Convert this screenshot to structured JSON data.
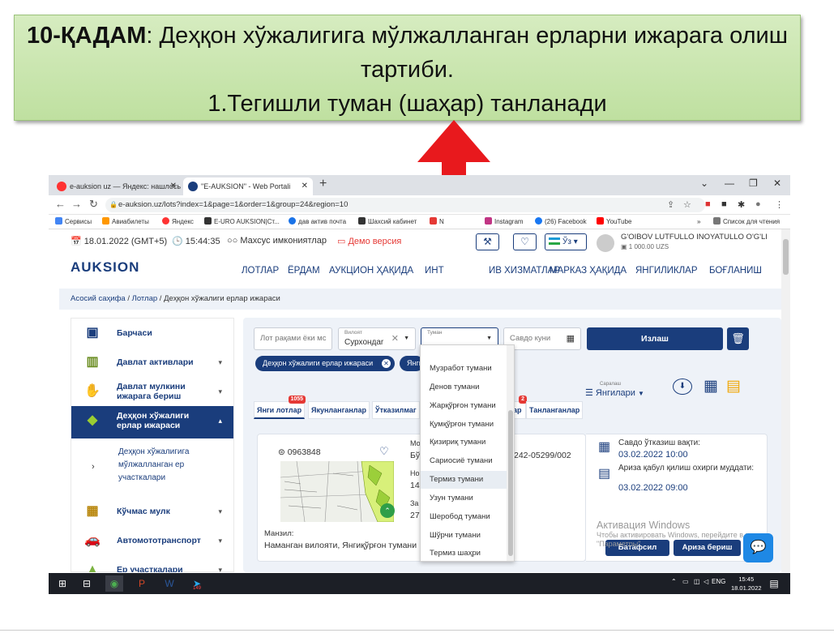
{
  "slide": {
    "step": "10-ҚАДАМ",
    "title_rest": ": Деҳқон хўжалигига мўлжалланган ерларни ижарага олиш тартиби.",
    "subtitle": "1.Тегишли туман (шаҳар) танланади"
  },
  "browser": {
    "tabs": [
      {
        "label": "e-auksion uz — Яндекс: нашлось"
      },
      {
        "label": "\"E-AUKSION\" - Web Portali"
      }
    ],
    "url": "e-auksion.uz/lots?index=1&page=1&order=1&group=24&region=10",
    "bookmarks": [
      "Сервисы",
      "Авиабилеты",
      "Яндекс",
      "E-URO AUKSION|Ст...",
      "дав актив почта",
      "Шахсий кабинет",
      "N",
      "Instagram",
      "(26) Facebook",
      "YouTube",
      "Список для чтения"
    ],
    "bookmarks_more": "»"
  },
  "site": {
    "date": "18.01.2022 (GMT+5)",
    "time": "15:44:35",
    "accessibility": "Махсус имкониятлар",
    "demo": "Демо версия",
    "lang": "Ўз",
    "user_name": "G'OIBOV LUTFULLO INOYATULLO O'G'LI",
    "balance": "1 000.00 UZS",
    "logo": "AUKSION",
    "menu": [
      "ЛОТЛАР",
      "ЁРДАМ",
      "АУКЦИОН ҲАҚИДА",
      "ИНТ",
      "ИВ ХИЗМАТЛАР",
      "МАРКАЗ ҲАҚИДА",
      "ЯНГИЛИКЛАР",
      "БОҒЛАНИШ"
    ],
    "breadcrumb": [
      "Асосий саҳифа",
      "Лотлар",
      "Деҳқон хўжалиги ерлар ижараси"
    ],
    "breadcrumb_sep": "/"
  },
  "sidebar": {
    "items": [
      {
        "label": "Барчаси",
        "icon": "grid-icon"
      },
      {
        "label": "Давлат активлари",
        "icon": "building-icon"
      },
      {
        "label": "Давлат мулкини ижарага бериш",
        "icon": "handshake-icon"
      },
      {
        "label": "Деҳқон хўжалиги ерлар ижараси",
        "icon": "farmland-icon"
      },
      {
        "label": "Кўчмас мулк",
        "icon": "apartment-icon"
      },
      {
        "label": "Автомототранспорт",
        "icon": "car-icon"
      },
      {
        "label": "Ер участкалари",
        "icon": "land-icon"
      }
    ],
    "subitem": "Деҳқон хўжалигига мўлжалланган ер участкалари"
  },
  "filters": {
    "lot_placeholder": "Лот рақами ёки мс",
    "region_label": "Вилоят",
    "region_value": "Сурхондаr",
    "district_label": "Туман",
    "date_placeholder": "Савдо куни",
    "search_btn": "Излаш",
    "chips": [
      "Деҳқон хўжалиги ерлар ижараси",
      "Янги"
    ],
    "sort_label": "Саралаш",
    "sort_value": "Янгилари"
  },
  "lot_tabs": [
    {
      "label": "Янги лотлар",
      "badge": "1055"
    },
    {
      "label": "Якунланганлар",
      "badge": ""
    },
    {
      "label": "Ўтказилмаг",
      "badge": ""
    },
    {
      "label": "ар",
      "badge": "2"
    },
    {
      "label": "Танланганлар",
      "badge": ""
    }
  ],
  "lot": {
    "number": "0963848",
    "col_fragments": [
      "Мо",
      "Бў",
      "Но",
      "14",
      "За",
      "27"
    ],
    "id_fragment": "242-05299/002",
    "address_label": "Манзил:",
    "address": "Наманган вилояти, Янгиқўрғон тумани",
    "auction_date_label": "Савдо ўтказиш вақти:",
    "auction_date": "03.02.2022 10:00",
    "deadline_label": "Ариза қабул қилиш охирги муддати:",
    "deadline": "03.02.2022 09:00",
    "details_btn": "Батафсил",
    "apply_btn": "Ариза бериш"
  },
  "district_options": [
    {
      "label": "Музработ тумани",
      "highlighted": false
    },
    {
      "label": "Денов тумани",
      "highlighted": false
    },
    {
      "label": "Жарқўрғон тумани",
      "highlighted": false
    },
    {
      "label": "Қумқўрғон тумани",
      "highlighted": false
    },
    {
      "label": "Қизириқ тумани",
      "highlighted": false
    },
    {
      "label": "Сариосиё тумани",
      "highlighted": false
    },
    {
      "label": "Термиз тумани",
      "highlighted": true
    },
    {
      "label": "Узун тумани",
      "highlighted": false
    },
    {
      "label": "Шеробод тумани",
      "highlighted": false
    },
    {
      "label": "Шўрчи тумани",
      "highlighted": false
    },
    {
      "label": "Термиз шаҳри",
      "highlighted": false
    }
  ],
  "watermark": {
    "line1": "Активация Windows",
    "line2": "Чтобы активировать Windows, перейдите в раздел \"Параметры\"."
  },
  "taskbar": {
    "lang": "ENG",
    "time": "15:45",
    "date": "18.01.2022",
    "telegram_badge": "149"
  },
  "colors": {
    "brand": "#1a3d7c",
    "arrow": "#e8191d",
    "banner": "#c9e7ae"
  }
}
